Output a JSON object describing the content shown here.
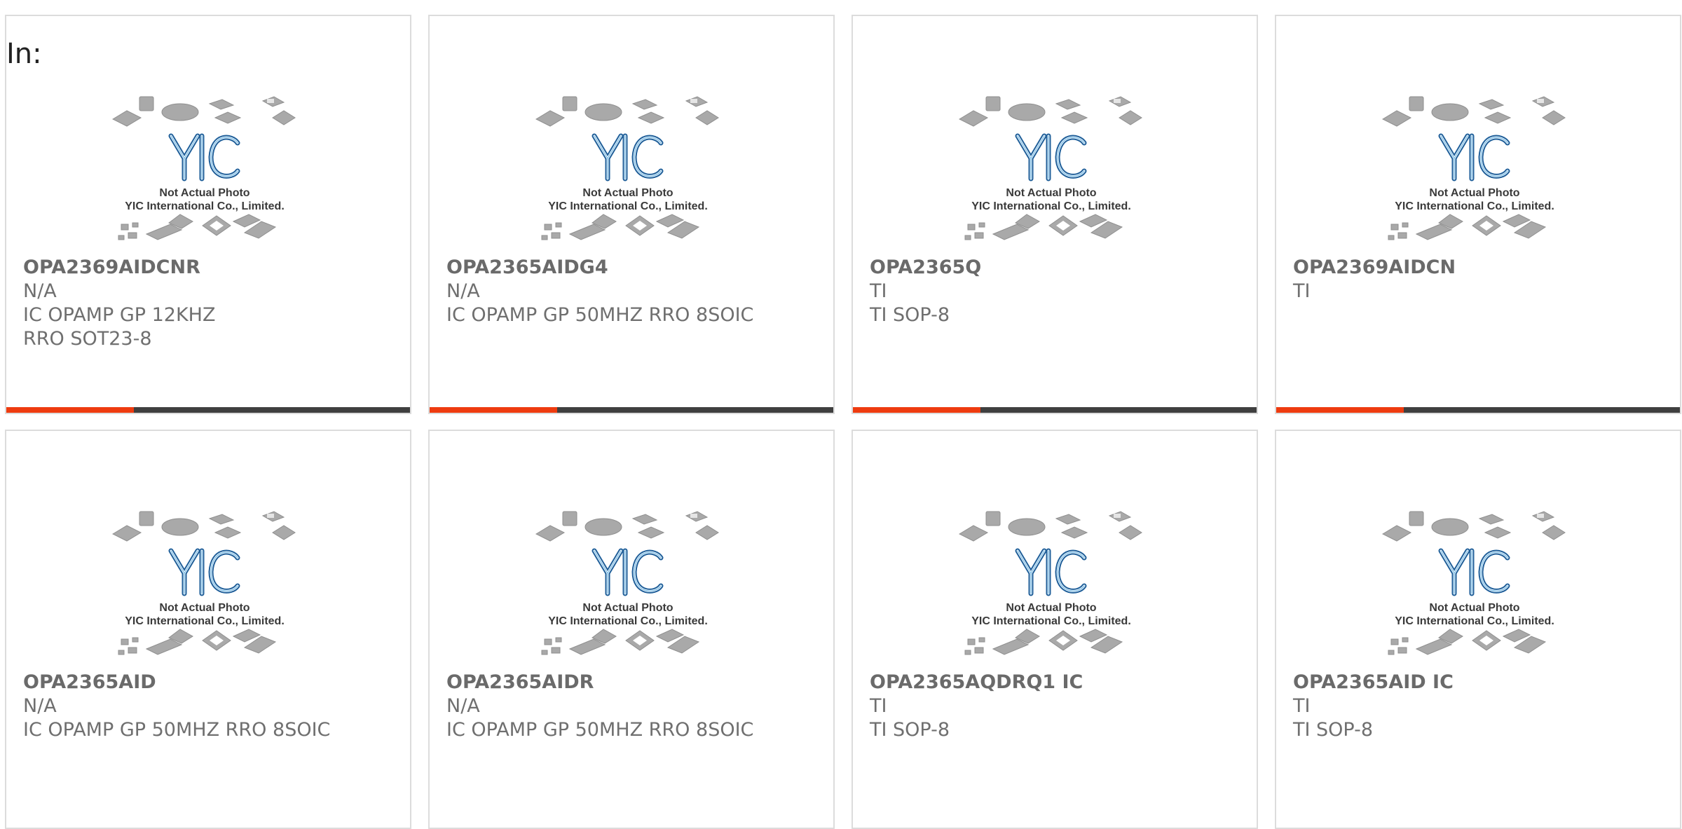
{
  "filter_label": "In:",
  "image_text": {
    "line1": "Not Actual Photo",
    "line2": "YIC International Co., Limited.",
    "logo": "YIC"
  },
  "colors": {
    "accent": "#ee3b0f",
    "bar_dark": "#3f3f3f",
    "logo_blue": "#2b86c5"
  },
  "products": [
    {
      "name": "OPA2369AIDCNR",
      "maker": "N/A",
      "desc": "IC OPAMP GP 12KHZ RRO SOT23-8",
      "show_bar": true
    },
    {
      "name": "OPA2365AIDG4",
      "maker": "N/A",
      "desc": "IC OPAMP GP 50MHZ RRO 8SOIC",
      "show_bar": true
    },
    {
      "name": "OPA2365Q",
      "maker": "TI",
      "desc": "TI SOP-8",
      "show_bar": true
    },
    {
      "name": "OPA2369AIDCN",
      "maker": "TI",
      "desc": "",
      "show_bar": true
    },
    {
      "name": "OPA2365AID",
      "maker": "N/A",
      "desc": "IC OPAMP GP 50MHZ RRO 8SOIC",
      "show_bar": false
    },
    {
      "name": "OPA2365AIDR",
      "maker": "N/A",
      "desc": "IC OPAMP GP 50MHZ RRO 8SOIC",
      "show_bar": false
    },
    {
      "name": "OPA2365AQDRQ1 IC",
      "maker": "TI",
      "desc": "TI SOP-8",
      "show_bar": false
    },
    {
      "name": "OPA2365AID IC",
      "maker": "TI",
      "desc": "TI SOP-8",
      "show_bar": false
    }
  ]
}
